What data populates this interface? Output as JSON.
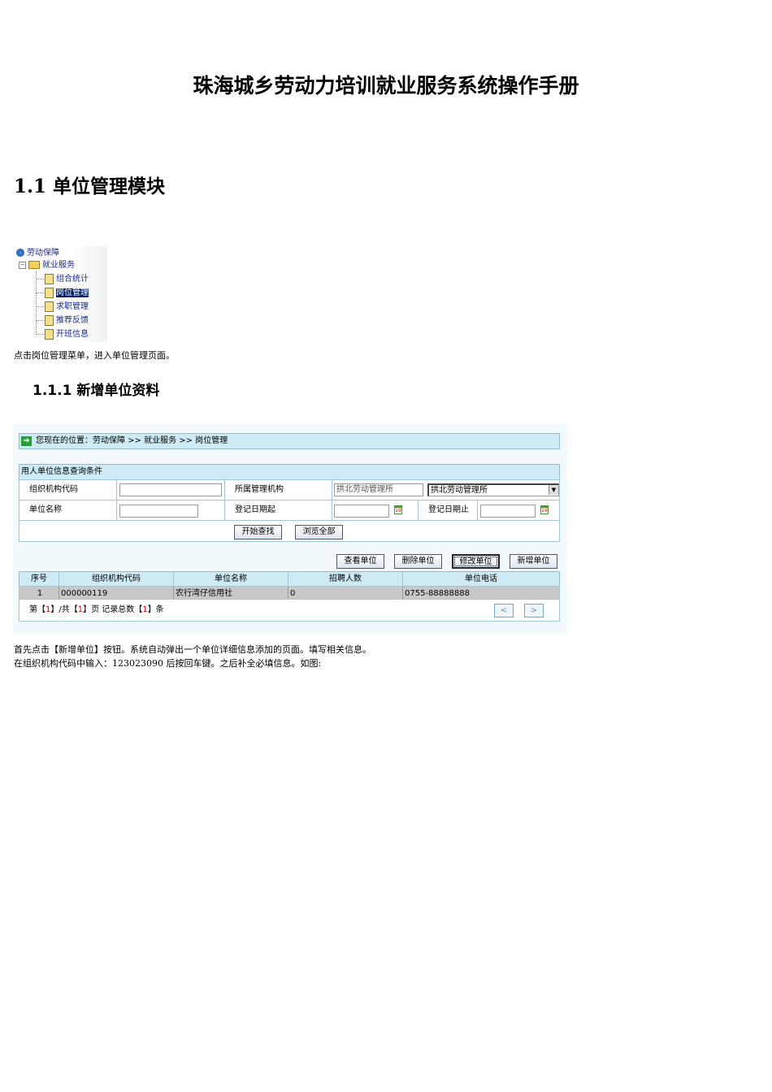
{
  "title": "珠海城乡劳动力培训就业服务系统操作手册",
  "section": "1.1 单位管理模块",
  "tree": {
    "root": "劳动保障",
    "folder": "就业服务",
    "items": [
      "组合统计",
      "岗位管理",
      "求职管理",
      "推荐反馈",
      "开班信息"
    ],
    "selected_index": 1
  },
  "caption1": "点击岗位管理菜单，进入单位管理页面。",
  "subsection": "1.1.1  新增单位资料",
  "app": {
    "breadcrumb": "您现在的位置：劳动保障 >> 就业服务 >> 岗位管理",
    "query": {
      "title": "用人单位信息查询条件",
      "org_code_label": "组织机构代码",
      "org_code_value": "",
      "mgmt_label": "所属管理机构",
      "mgmt_text": "拱北劳动管理所",
      "mgmt_select": "拱北劳动管理所",
      "name_label": "单位名称",
      "name_value": "",
      "date_from_label": "登记日期起",
      "date_to_label": "登记日期止",
      "search_btn": "开始查找",
      "browse_btn": "浏览全部"
    },
    "actions": [
      "查看单位",
      "删除单位",
      "修改单位",
      "新增单位"
    ],
    "table": {
      "headers": [
        "序号",
        "组织机构代码",
        "单位名称",
        "招聘人数",
        "单位电话"
      ],
      "rows": [
        [
          "1",
          "000000119",
          "农行湾仔信用社",
          "0",
          "0755-88888888"
        ]
      ]
    },
    "pager": {
      "p1": "第【",
      "cur": "1",
      "p2": "】/共【",
      "total": "1",
      "p3": "】页 记录总数【",
      "count": "1",
      "p4": "】条",
      "prev": "<",
      "next": ">"
    }
  },
  "para1": "首先点击【新增单位】按钮。系统自动弹出一个单位详细信息添加的页面。填写相关信息。",
  "para2": "在组织机构代码中输入：123023090 后按回车键。之后补全必填信息。如图:"
}
